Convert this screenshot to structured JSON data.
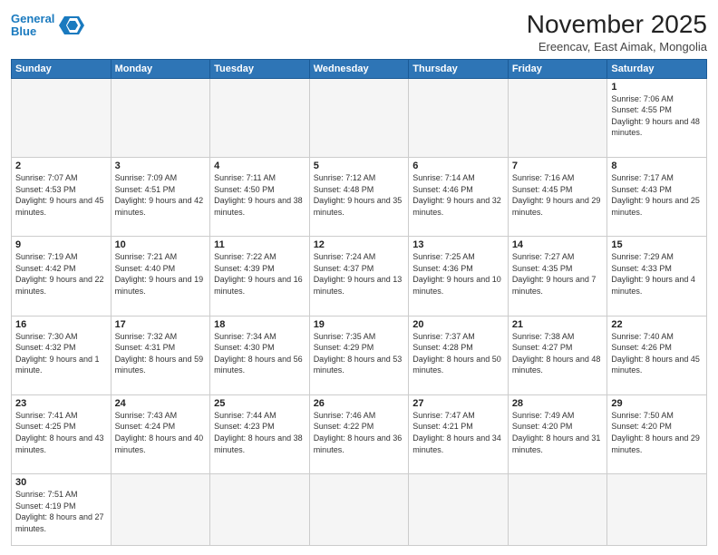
{
  "header": {
    "logo_line1": "General",
    "logo_line2": "Blue",
    "month_title": "November 2025",
    "subtitle": "Ereencav, East Aimak, Mongolia"
  },
  "weekdays": [
    "Sunday",
    "Monday",
    "Tuesday",
    "Wednesday",
    "Thursday",
    "Friday",
    "Saturday"
  ],
  "weeks": [
    [
      {
        "day": "",
        "info": ""
      },
      {
        "day": "",
        "info": ""
      },
      {
        "day": "",
        "info": ""
      },
      {
        "day": "",
        "info": ""
      },
      {
        "day": "",
        "info": ""
      },
      {
        "day": "",
        "info": ""
      },
      {
        "day": "1",
        "info": "Sunrise: 7:06 AM\nSunset: 4:55 PM\nDaylight: 9 hours\nand 48 minutes."
      }
    ],
    [
      {
        "day": "2",
        "info": "Sunrise: 7:07 AM\nSunset: 4:53 PM\nDaylight: 9 hours\nand 45 minutes."
      },
      {
        "day": "3",
        "info": "Sunrise: 7:09 AM\nSunset: 4:51 PM\nDaylight: 9 hours\nand 42 minutes."
      },
      {
        "day": "4",
        "info": "Sunrise: 7:11 AM\nSunset: 4:50 PM\nDaylight: 9 hours\nand 38 minutes."
      },
      {
        "day": "5",
        "info": "Sunrise: 7:12 AM\nSunset: 4:48 PM\nDaylight: 9 hours\nand 35 minutes."
      },
      {
        "day": "6",
        "info": "Sunrise: 7:14 AM\nSunset: 4:46 PM\nDaylight: 9 hours\nand 32 minutes."
      },
      {
        "day": "7",
        "info": "Sunrise: 7:16 AM\nSunset: 4:45 PM\nDaylight: 9 hours\nand 29 minutes."
      },
      {
        "day": "8",
        "info": "Sunrise: 7:17 AM\nSunset: 4:43 PM\nDaylight: 9 hours\nand 25 minutes."
      }
    ],
    [
      {
        "day": "9",
        "info": "Sunrise: 7:19 AM\nSunset: 4:42 PM\nDaylight: 9 hours\nand 22 minutes."
      },
      {
        "day": "10",
        "info": "Sunrise: 7:21 AM\nSunset: 4:40 PM\nDaylight: 9 hours\nand 19 minutes."
      },
      {
        "day": "11",
        "info": "Sunrise: 7:22 AM\nSunset: 4:39 PM\nDaylight: 9 hours\nand 16 minutes."
      },
      {
        "day": "12",
        "info": "Sunrise: 7:24 AM\nSunset: 4:37 PM\nDaylight: 9 hours\nand 13 minutes."
      },
      {
        "day": "13",
        "info": "Sunrise: 7:25 AM\nSunset: 4:36 PM\nDaylight: 9 hours\nand 10 minutes."
      },
      {
        "day": "14",
        "info": "Sunrise: 7:27 AM\nSunset: 4:35 PM\nDaylight: 9 hours\nand 7 minutes."
      },
      {
        "day": "15",
        "info": "Sunrise: 7:29 AM\nSunset: 4:33 PM\nDaylight: 9 hours\nand 4 minutes."
      }
    ],
    [
      {
        "day": "16",
        "info": "Sunrise: 7:30 AM\nSunset: 4:32 PM\nDaylight: 9 hours\nand 1 minute."
      },
      {
        "day": "17",
        "info": "Sunrise: 7:32 AM\nSunset: 4:31 PM\nDaylight: 8 hours\nand 59 minutes."
      },
      {
        "day": "18",
        "info": "Sunrise: 7:34 AM\nSunset: 4:30 PM\nDaylight: 8 hours\nand 56 minutes."
      },
      {
        "day": "19",
        "info": "Sunrise: 7:35 AM\nSunset: 4:29 PM\nDaylight: 8 hours\nand 53 minutes."
      },
      {
        "day": "20",
        "info": "Sunrise: 7:37 AM\nSunset: 4:28 PM\nDaylight: 8 hours\nand 50 minutes."
      },
      {
        "day": "21",
        "info": "Sunrise: 7:38 AM\nSunset: 4:27 PM\nDaylight: 8 hours\nand 48 minutes."
      },
      {
        "day": "22",
        "info": "Sunrise: 7:40 AM\nSunset: 4:26 PM\nDaylight: 8 hours\nand 45 minutes."
      }
    ],
    [
      {
        "day": "23",
        "info": "Sunrise: 7:41 AM\nSunset: 4:25 PM\nDaylight: 8 hours\nand 43 minutes."
      },
      {
        "day": "24",
        "info": "Sunrise: 7:43 AM\nSunset: 4:24 PM\nDaylight: 8 hours\nand 40 minutes."
      },
      {
        "day": "25",
        "info": "Sunrise: 7:44 AM\nSunset: 4:23 PM\nDaylight: 8 hours\nand 38 minutes."
      },
      {
        "day": "26",
        "info": "Sunrise: 7:46 AM\nSunset: 4:22 PM\nDaylight: 8 hours\nand 36 minutes."
      },
      {
        "day": "27",
        "info": "Sunrise: 7:47 AM\nSunset: 4:21 PM\nDaylight: 8 hours\nand 34 minutes."
      },
      {
        "day": "28",
        "info": "Sunrise: 7:49 AM\nSunset: 4:20 PM\nDaylight: 8 hours\nand 31 minutes."
      },
      {
        "day": "29",
        "info": "Sunrise: 7:50 AM\nSunset: 4:20 PM\nDaylight: 8 hours\nand 29 minutes."
      }
    ],
    [
      {
        "day": "30",
        "info": "Sunrise: 7:51 AM\nSunset: 4:19 PM\nDaylight: 8 hours\nand 27 minutes."
      },
      {
        "day": "",
        "info": ""
      },
      {
        "day": "",
        "info": ""
      },
      {
        "day": "",
        "info": ""
      },
      {
        "day": "",
        "info": ""
      },
      {
        "day": "",
        "info": ""
      },
      {
        "day": "",
        "info": ""
      }
    ]
  ]
}
